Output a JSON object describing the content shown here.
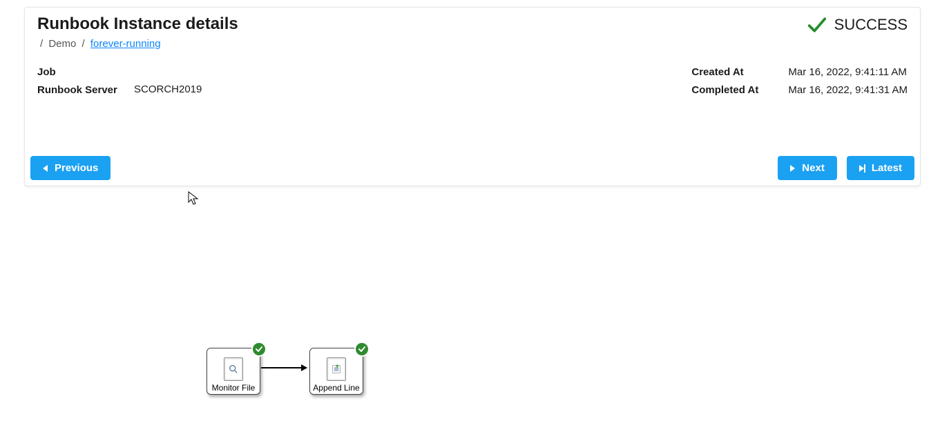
{
  "header": {
    "title": "Runbook Instance details",
    "breadcrumb": {
      "segment1": "Demo",
      "segment2": "forever-running"
    },
    "status": {
      "label": "SUCCESS"
    }
  },
  "details": {
    "job_label": "Job",
    "job_value": "",
    "server_label": "Runbook Server",
    "server_value": "SCORCH2019",
    "created_label": "Created At",
    "created_value": "Mar 16, 2022, 9:41:11 AM",
    "completed_label": "Completed At",
    "completed_value": "Mar 16, 2022, 9:41:31 AM"
  },
  "nav": {
    "previous": "Previous",
    "next": "Next",
    "latest": "Latest"
  },
  "diagram": {
    "activities": [
      {
        "name": "Monitor File",
        "status": "success"
      },
      {
        "name": "Append Line",
        "status": "success"
      }
    ]
  }
}
